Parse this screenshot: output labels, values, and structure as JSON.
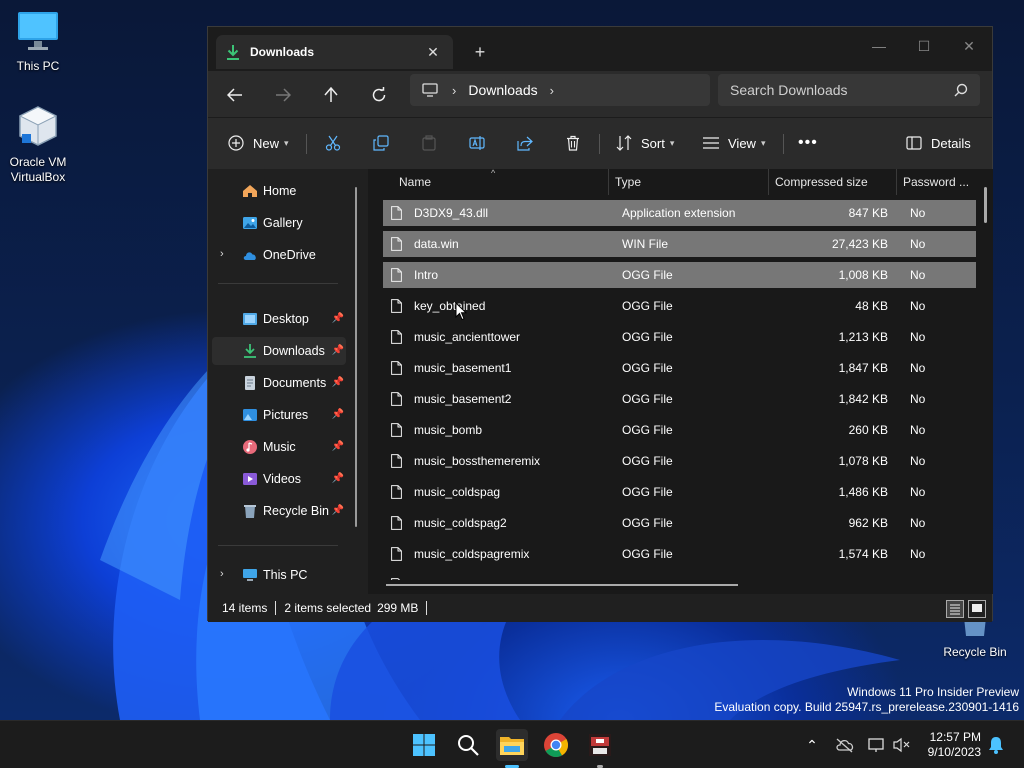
{
  "desktop": {
    "icons": [
      {
        "label": "This PC"
      },
      {
        "label": "Oracle VM VirtualBox"
      },
      {
        "label": "Recycle Bin"
      }
    ],
    "watermark_line1": "Windows 11 Pro Insider Preview",
    "watermark_line2": "Evaluation copy. Build 25947.rs_prerelease.230901-1416"
  },
  "window": {
    "tab_title": "Downloads",
    "address": {
      "current": "Downloads"
    },
    "search_placeholder": "Search Downloads",
    "toolbar": {
      "new": "New",
      "sort": "Sort",
      "view": "View",
      "details": "Details"
    },
    "sidebar": [
      {
        "label": "Home",
        "icon": "home-icon"
      },
      {
        "label": "Gallery",
        "icon": "gallery-icon"
      },
      {
        "label": "OneDrive",
        "icon": "cloud-icon"
      },
      {
        "label": "Desktop",
        "icon": "desktop-icon"
      },
      {
        "label": "Downloads",
        "icon": "download-icon"
      },
      {
        "label": "Documents",
        "icon": "document-icon"
      },
      {
        "label": "Pictures",
        "icon": "pictures-icon"
      },
      {
        "label": "Music",
        "icon": "music-icon"
      },
      {
        "label": "Videos",
        "icon": "videos-icon"
      },
      {
        "label": "Recycle Bin",
        "icon": "recycle-bin-icon"
      },
      {
        "label": "This PC",
        "icon": "computer-icon"
      }
    ],
    "columns": [
      "Name",
      "Type",
      "Compressed size",
      "Password ..."
    ],
    "files": [
      {
        "name": "D3DX9_43.dll",
        "type": "Application extension",
        "size": "847 KB",
        "password": "No",
        "selected": true
      },
      {
        "name": "data.win",
        "type": "WIN File",
        "size": "27,423 KB",
        "password": "No",
        "selected": true
      },
      {
        "name": "Intro",
        "type": "OGG File",
        "size": "1,008 KB",
        "password": "No",
        "selected": true
      },
      {
        "name": "key_obtained",
        "type": "OGG File",
        "size": "48 KB",
        "password": "No",
        "selected": false
      },
      {
        "name": "music_ancienttower",
        "type": "OGG File",
        "size": "1,213 KB",
        "password": "No",
        "selected": false
      },
      {
        "name": "music_basement1",
        "type": "OGG File",
        "size": "1,847 KB",
        "password": "No",
        "selected": false
      },
      {
        "name": "music_basement2",
        "type": "OGG File",
        "size": "1,842 KB",
        "password": "No",
        "selected": false
      },
      {
        "name": "music_bomb",
        "type": "OGG File",
        "size": "260 KB",
        "password": "No",
        "selected": false
      },
      {
        "name": "music_bossthemeremix",
        "type": "OGG File",
        "size": "1,078 KB",
        "password": "No",
        "selected": false
      },
      {
        "name": "music_coldspag",
        "type": "OGG File",
        "size": "1,486 KB",
        "password": "No",
        "selected": false
      },
      {
        "name": "music_coldspag2",
        "type": "OGG File",
        "size": "962 KB",
        "password": "No",
        "selected": false
      },
      {
        "name": "music_coldspagremix",
        "type": "OGG File",
        "size": "1,574 KB",
        "password": "No",
        "selected": false
      }
    ],
    "status": {
      "items": "14 items",
      "selected": "2 items selected",
      "size": "299 MB"
    }
  },
  "taskbar": {
    "time": "12:57 PM",
    "date": "9/10/2023"
  },
  "colors": {
    "accent": "#4cc2ff",
    "selection": "#777777",
    "download_green": "#3cc477"
  }
}
